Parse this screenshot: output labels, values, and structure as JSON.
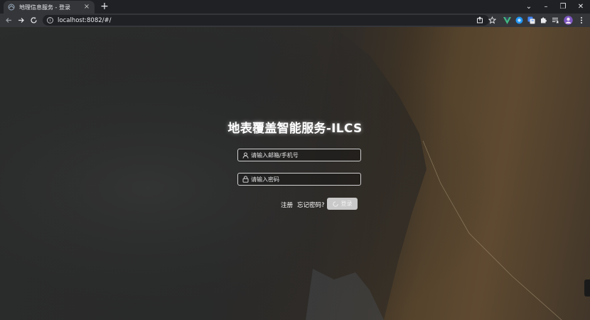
{
  "browser": {
    "tab_title": "地理信息服务 - 登录",
    "tab_close": "×",
    "new_tab": "+",
    "url": "localhost:8082/#/",
    "window_controls": {
      "menu": "⌄",
      "minimize": "–",
      "restore": "❐",
      "close": "✕"
    }
  },
  "login": {
    "title": "地表覆盖智能服务-ILCS",
    "account_placeholder": "请输入邮箱/手机号",
    "password_placeholder": "请输入密码",
    "register_label": "注册",
    "forgot_label": "忘记密码?",
    "login_label": "登录"
  },
  "icons": [
    "back-icon",
    "forward-icon",
    "reload-icon",
    "info-icon",
    "share-icon",
    "star-icon",
    "extension-icons",
    "profile-avatar",
    "menu-icon",
    "user-icon",
    "lock-icon",
    "loading-icon"
  ],
  "colors": {
    "chrome_dark": "#202124",
    "chrome_tab": "#35363a",
    "button": "#c9c9c9"
  }
}
